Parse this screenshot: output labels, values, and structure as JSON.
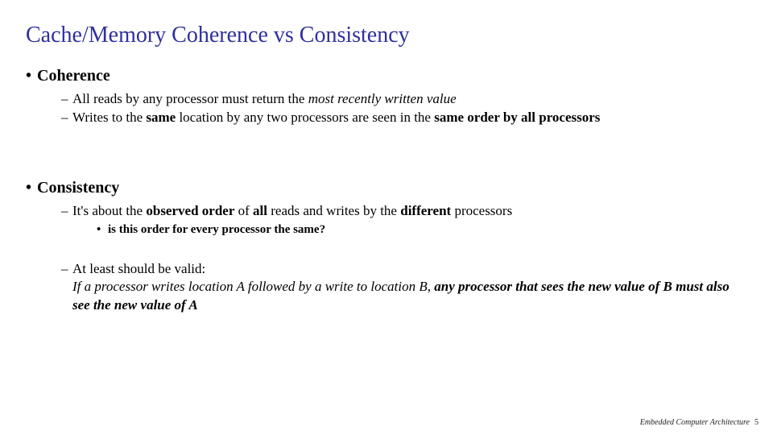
{
  "title": "Cache/Memory Coherence vs Consistency",
  "sections": {
    "coherence": {
      "heading": "Coherence",
      "items": {
        "a_pre": "All reads by any processor must return the ",
        "a_em": "most recently written value",
        "b_pre": "Writes to the ",
        "b_bold1": "same",
        "b_mid": " location by any two processors are seen in the ",
        "b_bold2": "same order by all processors"
      }
    },
    "consistency": {
      "heading": "Consistency",
      "items": {
        "a_pre": "It's about the ",
        "a_bold1": "observed order",
        "a_mid1": " of ",
        "a_bold2": "all",
        "a_mid2": " reads and writes by the ",
        "a_bold3": "different",
        "a_post": " processors",
        "a_sub": "is this order for every processor the same?",
        "b_text": "At least should be valid:",
        "b_cont_em1": "If a processor writes location A followed by a write to location B, ",
        "b_cont_bold": "any processor that sees the new value of B must also see the new value of A"
      }
    }
  },
  "footer": {
    "course": "Embedded Computer Architecture",
    "page": "5"
  }
}
